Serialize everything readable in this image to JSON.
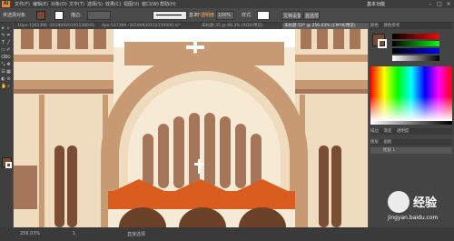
{
  "menubar": {
    "logo": "Ai",
    "menus": [
      "文件(F)",
      "编辑(E)",
      "对象(O)",
      "文字(T)",
      "选择(S)",
      "效果(C)",
      "视图(V)",
      "窗口(W)",
      "帮助(H)"
    ],
    "workspace": "基本功能",
    "window_controls": [
      "–",
      "□",
      "×"
    ]
  },
  "controlbar": {
    "selection": "未选择对象",
    "stroke_label": "描边:",
    "brush_label": "基本",
    "opacity_label": "不透明度:",
    "opacity_value": "100%",
    "style_label": "样式:",
    "doc_settings": "文档设置",
    "prefs": "首选项"
  },
  "tabs": [
    {
      "label": "10px-7262396 -20190920101128031.ai*",
      "active": false
    },
    {
      "label": "4px-537399 -20190920152150000.ai*",
      "active": false
    },
    {
      "label": "未标题-35 @ 88.3% (RGB/预览)",
      "active": false
    },
    {
      "label": "未标题-52* @ 256.03% (CMYK/预览)",
      "active": true
    }
  ],
  "tools": [
    "▸",
    "▹",
    "✎",
    "✒",
    "T",
    "╱",
    "▭",
    "✐",
    "⌫",
    "⟲",
    "⤡",
    "✥",
    "☰",
    "▦",
    "◐",
    "⊘",
    "✋",
    "⌕"
  ],
  "colors": {
    "fill": "#7b4a35",
    "stroke": "#ffffff",
    "sky": "#ffffff",
    "tan_light": "#efdcbe",
    "tan_mid": "#c79a73",
    "tan_dark": "#a6765a",
    "brown": "#7a4d35",
    "brown_dark": "#5a3424",
    "orange": "#d95d1f",
    "cream": "#f7ead4"
  },
  "panel": {
    "tabs": [
      "颜色",
      "颜色参考"
    ],
    "bottom_tabs": [
      "描边",
      "渐变",
      "透明度"
    ],
    "layer_tabs": [
      "图层",
      "画板"
    ],
    "layer_name": "图层 1"
  },
  "status": {
    "zoom": "256.03%",
    "page": "1",
    "tool": "直接选择",
    "watermark_text": "经验",
    "watermark_url": "jingyan.baidu.com",
    "watermark_brand": "Bai"
  }
}
